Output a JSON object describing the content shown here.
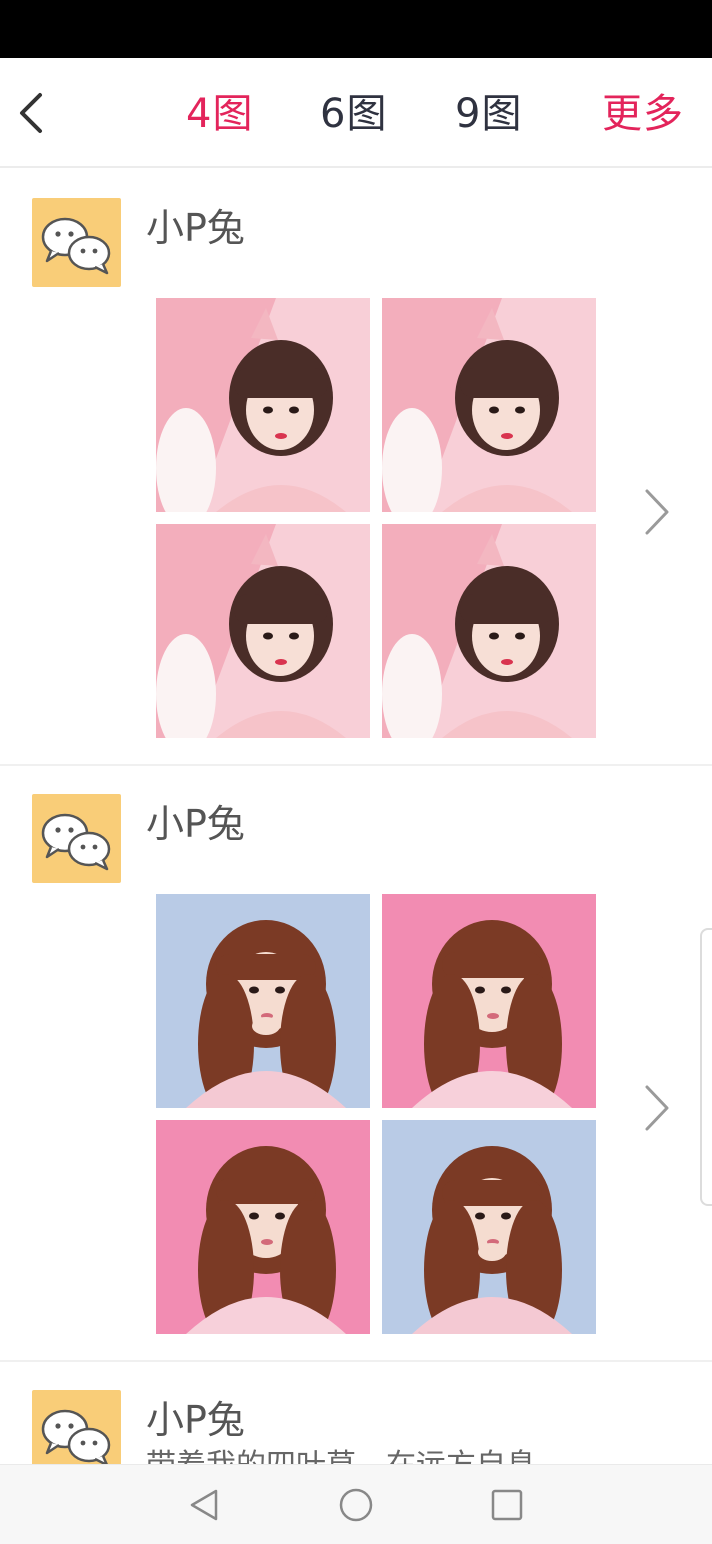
{
  "nav": {
    "tabs": [
      {
        "label": "4图",
        "active": true
      },
      {
        "label": "6图",
        "active": false
      },
      {
        "label": "9图",
        "active": false
      }
    ],
    "more_label": "更多"
  },
  "feed": [
    {
      "username": "小P兔",
      "avatar_icon": "wechat-icon",
      "photos": 4,
      "theme": "pink"
    },
    {
      "username": "小P兔",
      "avatar_icon": "wechat-icon",
      "photos": 4,
      "theme": "pink-blue"
    },
    {
      "username": "小P兔",
      "subtitle": "带着我的四叶草，在远方自息",
      "avatar_icon": "wechat-icon"
    }
  ],
  "colors": {
    "accent": "#e3245b",
    "avatar_bg": "#f9cd78",
    "tab_text": "#2f3240"
  },
  "system_nav": [
    "back-triangle-icon",
    "home-circle-icon",
    "recents-square-icon"
  ]
}
